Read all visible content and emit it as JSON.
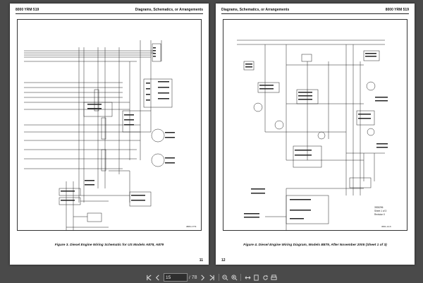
{
  "left_page": {
    "header_left": "8000 YRM 519",
    "header_right": "Diagrams, Schematics, or Arrangements",
    "caption": "Figure 3. Diesel Engine Wiring Schematic for US Models A878, A879",
    "page_number": "11",
    "figure_code": "3883-1779"
  },
  "right_page": {
    "header_left": "Diagrams, Schematics, or Arrangements",
    "header_right": "8000 YRM 519",
    "caption": "Figure 4. Diesel Engine Wiring Diagram, Models B879, After November 2005 (Sheet 1 of 3)",
    "page_number": "12",
    "sheet_info_1": "3928296",
    "sheet_info_2": "Sheet 1 of 3",
    "sheet_info_3": "Revision 0",
    "figure_code": "3661-14-6"
  },
  "toolbar": {
    "current_page": "15",
    "total_pages": "78",
    "icons": [
      "first-page-icon",
      "prev-page-icon",
      "next-page-icon",
      "last-page-icon",
      "zoom-out-icon",
      "zoom-in-icon",
      "fit-width-icon",
      "fit-page-icon",
      "rotate-icon",
      "print-icon"
    ]
  },
  "colors": {
    "background": "#4a4a4a",
    "page": "#ffffff",
    "line": "#222222"
  }
}
